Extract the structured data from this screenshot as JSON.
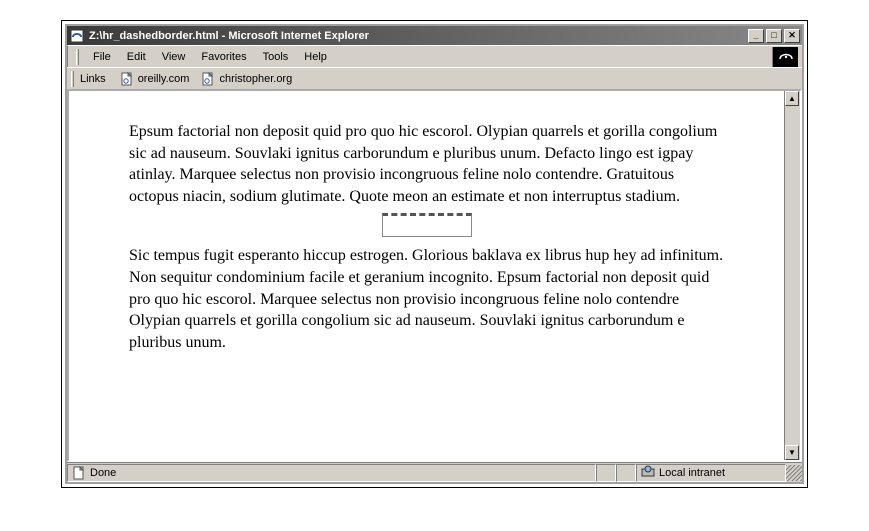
{
  "window": {
    "title": "Z:\\hr_dashedborder.html - Microsoft Internet Explorer",
    "controls": {
      "minimize": "_",
      "maximize": "□",
      "close": "✕"
    }
  },
  "menu": [
    "File",
    "Edit",
    "View",
    "Favorites",
    "Tools",
    "Help"
  ],
  "linksbar": {
    "label": "Links",
    "items": [
      "oreilly.com",
      "christopher.org"
    ]
  },
  "content": {
    "paragraph1": "Epsum factorial non deposit quid pro quo hic escorol. Olypian quarrels et gorilla congolium sic ad nauseum. Souvlaki ignitus carborundum e pluribus unum. Defacto lingo est igpay atinlay. Marquee selectus non provisio incongruous feline nolo contendre. Gratuitous octopus niacin, sodium glutimate. Quote meon an estimate et non interruptus stadium.",
    "paragraph2": "Sic tempus fugit esperanto hiccup estrogen. Glorious baklava ex librus hup hey ad infinitum. Non sequitur condominium facile et geranium incognito. Epsum factorial non deposit quid pro quo hic escorol. Marquee selectus non provisio incongruous feline nolo contendre Olypian quarrels et gorilla congolium sic ad nauseum. Souvlaki ignitus carborundum e pluribus unum."
  },
  "statusbar": {
    "status": "Done",
    "zone": "Local intranet"
  },
  "scrollbar": {
    "up": "▲",
    "down": "▼"
  }
}
